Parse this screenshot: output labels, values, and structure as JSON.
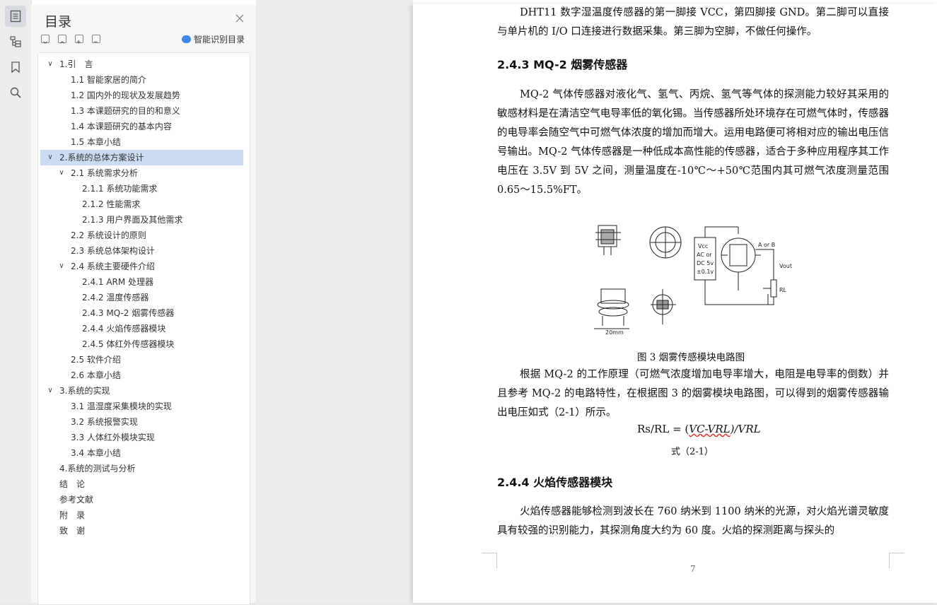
{
  "toc": {
    "title": "目录",
    "smart_label": "智能识别目录",
    "items": [
      {
        "label": "1.引　言",
        "level": 0,
        "chevron": "v",
        "selected": false
      },
      {
        "label": "1.1  智能家居的简介",
        "level": 1,
        "chevron": "",
        "selected": false
      },
      {
        "label": "1.2  国内外的现状及发展趋势",
        "level": 1,
        "chevron": "",
        "selected": false
      },
      {
        "label": "1.3  本课题研究的目的和意义",
        "level": 1,
        "chevron": "",
        "selected": false
      },
      {
        "label": "1.4  本课题研究的基本内容",
        "level": 1,
        "chevron": "",
        "selected": false
      },
      {
        "label": "1.5  本章小结",
        "level": 1,
        "chevron": "",
        "selected": false
      },
      {
        "label": "2.系统的总体方案设计",
        "level": 0,
        "chevron": "v",
        "selected": true
      },
      {
        "label": "2.1  系统需求分析",
        "level": 1,
        "chevron": "v",
        "selected": false
      },
      {
        "label": "2.1.1  系统功能需求",
        "level": 2,
        "chevron": "",
        "selected": false
      },
      {
        "label": "2.1.2  性能需求",
        "level": 2,
        "chevron": "",
        "selected": false
      },
      {
        "label": "2.1.3  用户界面及其他需求",
        "level": 2,
        "chevron": "",
        "selected": false
      },
      {
        "label": "2.2  系统设计的原则",
        "level": 1,
        "chevron": "",
        "selected": false
      },
      {
        "label": "2.3  系统总体架构设计",
        "level": 1,
        "chevron": "",
        "selected": false
      },
      {
        "label": "2.4  系统主要硬件介绍",
        "level": 1,
        "chevron": "v",
        "selected": false
      },
      {
        "label": "2.4.1 ARM 处理器",
        "level": 2,
        "chevron": "",
        "selected": false
      },
      {
        "label": "2.4.2  温度传感器",
        "level": 2,
        "chevron": "",
        "selected": false
      },
      {
        "label": "2.4.3 MQ-2 烟雾传感器",
        "level": 2,
        "chevron": "",
        "selected": false
      },
      {
        "label": "2.4.4  火焰传感器模块",
        "level": 2,
        "chevron": "",
        "selected": false
      },
      {
        "label": "2.4.5  体红外传感器模块",
        "level": 2,
        "chevron": "",
        "selected": false
      },
      {
        "label": "2.5  软件介绍",
        "level": 1,
        "chevron": "",
        "selected": false
      },
      {
        "label": "2.6  本章小结",
        "level": 1,
        "chevron": "",
        "selected": false
      },
      {
        "label": "3.系统的实现",
        "level": 0,
        "chevron": "v",
        "selected": false
      },
      {
        "label": "3.1  温湿度采集模块的实现",
        "level": 1,
        "chevron": "",
        "selected": false
      },
      {
        "label": "3.2  系统报警实现",
        "level": 1,
        "chevron": "",
        "selected": false
      },
      {
        "label": "3.3  人体红外模块实现",
        "level": 1,
        "chevron": "",
        "selected": false
      },
      {
        "label": "3.4  本章小结",
        "level": 1,
        "chevron": "",
        "selected": false
      },
      {
        "label": "4.系统的测试与分析",
        "level": 0,
        "chevron": "",
        "selected": false
      },
      {
        "label": "结　论",
        "level": 0,
        "chevron": "",
        "selected": false
      },
      {
        "label": "参考文献",
        "level": 0,
        "chevron": "",
        "selected": false
      },
      {
        "label": "附　录",
        "level": 0,
        "chevron": "",
        "selected": false
      },
      {
        "label": "致　谢",
        "level": 0,
        "chevron": "",
        "selected": false
      }
    ]
  },
  "doc": {
    "para1": "DHT11 数字湿温度传感器的第一脚接 VCC，第四脚接 GND。第二脚可以直接与单片机的  I/O  口连接进行数据采集。第三脚为空脚，不做任何操作。",
    "heading1": "2.4.3 MQ-2 烟雾传感器",
    "para2": "MQ-2 气体传感器对液化气、氢气、丙烷、氢气等气体的探测能力较好其采用的敏感材料是在清洁空气电导率低的氧化锡。当传感器所处环境存在可燃气体时，传感器的电导率会随空气中可燃气体浓度的增加而增大。运用电路便可将相对应的输出电压信号输出。MQ-2 气体传感器是一种低成本高性能的传感器，适合于多种应用程序其工作电压在 3.5V 到 5V 之间，测量温度在-10℃～+50℃范围内其可燃气浓度测量范围 0.65～15.5%FT。",
    "figure_caption": "图 3  烟雾传感模块电路图",
    "para3": "根据 MQ-2 的工作原理（可燃气浓度增加电导率增大，电阻是电导率的倒数）并且参考 MQ-2 的电路特性，在根据图 3 的烟雾模块电路图，可以得到的烟雾传感器输出电压如式（2-1）所示。",
    "formula_left": "Rs/RL = (",
    "formula_mid": "VC-VRL",
    "formula_right": ")/VRL",
    "formula_caption": "式（2-1）",
    "heading2": "2.4.4  火焰传感器模块",
    "para4": "火焰传感器能够检测到波长在 760 纳米到 1100 纳米的光源，对火焰光谱灵敏度具有较强的识别能力，其探测角度大约为 60 度。火焰的探测距离与探头的",
    "page_number": "7",
    "fig_labels": {
      "vcc": "Vcc",
      "ac": "AC or",
      "dc": "DC 5v",
      "tol": "±0.1v",
      "aorb": "A or B",
      "vout": "Vout",
      "rl": "RL",
      "dim": "20mm"
    }
  },
  "colors": {
    "selected_bg": "#cddcf5",
    "accent": "#3d86f3"
  }
}
